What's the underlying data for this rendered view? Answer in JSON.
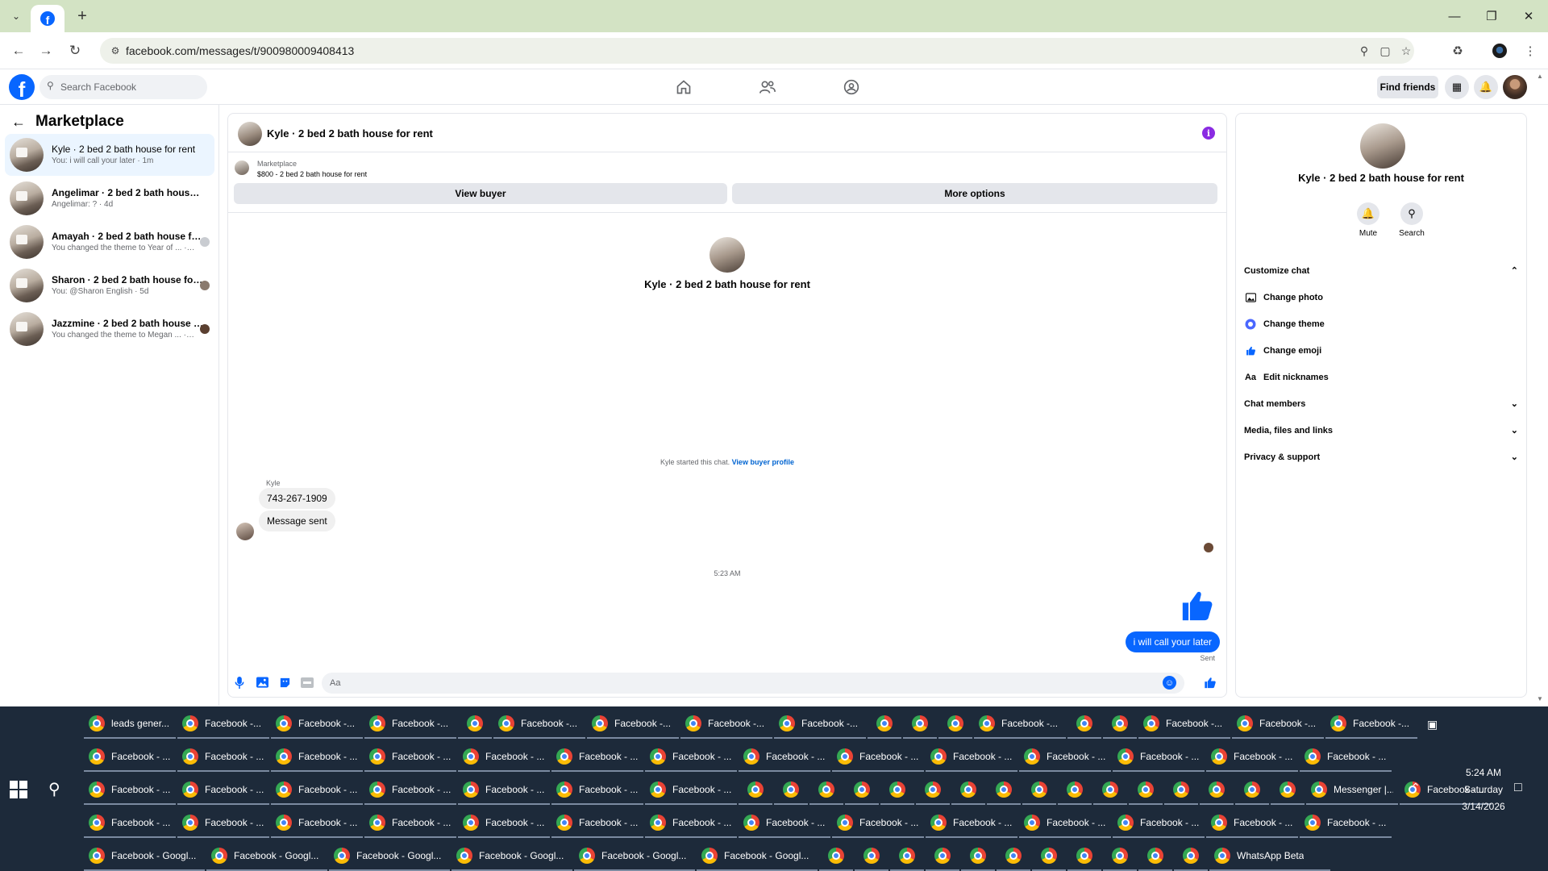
{
  "browser": {
    "url": "facebook.com/messages/t/900980009408413"
  },
  "fb": {
    "search_placeholder": "Search Facebook",
    "find_friends": "Find friends"
  },
  "sidebar": {
    "title": "Marketplace",
    "chats": [
      {
        "name": "Kyle · 2 bed 2 bath house for rent",
        "preview": "You: i will call your later · 1m",
        "active": true
      },
      {
        "name": "Angelimar · 2 bed 2 bath house fo...",
        "preview": "Angelimar: ? · 4d",
        "active": false
      },
      {
        "name": "Amayah · 2 bed 2 bath house fo...",
        "preview": "You changed the theme to Year of ... · 4d",
        "active": false
      },
      {
        "name": "Sharon · 2 bed 2 bath house for ...",
        "preview": "You: @Sharon English · 5d",
        "active": false
      },
      {
        "name": "Jazzmine · 2 bed 2 bath house f...",
        "preview": "You changed the theme to Megan ... · 1w",
        "active": false
      }
    ]
  },
  "conversation": {
    "title": "Kyle · 2 bed 2 bath house for rent",
    "listing_source": "Marketplace",
    "listing_price": "$800 - 2 bed 2 bath house for rent",
    "view_buyer": "View buyer",
    "more_options": "More options",
    "center_title": "Kyle · 2 bed 2 bath house for rent",
    "started_text": "Kyle started this chat.",
    "view_buyer_profile": "View buyer profile",
    "sender": "Kyle",
    "messages_in": [
      "743-267-1909",
      "Message sent"
    ],
    "time": "5:23 AM",
    "message_out": "i will call your later",
    "sent": "Sent",
    "composer_placeholder": "Aa"
  },
  "details": {
    "title": "Kyle · 2 bed 2 bath house for rent",
    "mute": "Mute",
    "search": "Search",
    "customize": "Customize chat",
    "change_photo": "Change photo",
    "change_theme": "Change theme",
    "change_emoji": "Change emoji",
    "edit_nicknames": "Edit nicknames",
    "chat_members": "Chat members",
    "media": "Media, files and links",
    "privacy": "Privacy & support",
    "nick_glyph": "Aa"
  },
  "taskbar": {
    "rows": [
      [
        "leads gener...",
        "Facebook -...",
        "Facebook -...",
        "Facebook -...",
        "",
        "Facebook -...",
        "Facebook -...",
        "Facebook -...",
        "Facebook -...",
        "",
        "",
        "",
        "Facebook -...",
        "",
        "",
        "Facebook -...",
        "Facebook -...",
        "Facebook -..."
      ],
      [
        "Facebook - ...",
        "Facebook - ...",
        "Facebook - ...",
        "Facebook - ...",
        "Facebook - ...",
        "Facebook - ...",
        "Facebook - ...",
        "Facebook - ...",
        "Facebook - ...",
        "Facebook - ...",
        "Facebook - ...",
        "Facebook - ...",
        "Facebook - ...",
        "Facebook - ..."
      ],
      [
        "Facebook - ...",
        "Facebook - ...",
        "Facebook - ...",
        "Facebook - ...",
        "Facebook - ...",
        "Facebook - ...",
        "Facebook - ...",
        "",
        "",
        "",
        "",
        "",
        "",
        "",
        "",
        "",
        "",
        "",
        "",
        "",
        "",
        "",
        "",
        "Messenger |...",
        "Facebook - ..."
      ],
      [
        "Facebook - ...",
        "Facebook - ...",
        "Facebook - ...",
        "Facebook - ...",
        "Facebook - ...",
        "Facebook - ...",
        "Facebook - ...",
        "Facebook - ...",
        "Facebook - ...",
        "Facebook - ...",
        "Facebook - ...",
        "Facebook - ...",
        "Facebook - ...",
        "Facebook - ..."
      ],
      [
        "Facebook - Googl...",
        "Facebook - Googl...",
        "Facebook - Googl...",
        "Facebook - Googl...",
        "Facebook - Googl...",
        "Facebook - Googl...",
        "",
        "",
        "",
        "",
        "",
        "",
        "",
        "",
        "",
        "",
        "",
        "WhatsApp Beta"
      ]
    ],
    "clock_time": "5:24 AM",
    "clock_day": "Saturday",
    "clock_date": "3/14/2026"
  }
}
